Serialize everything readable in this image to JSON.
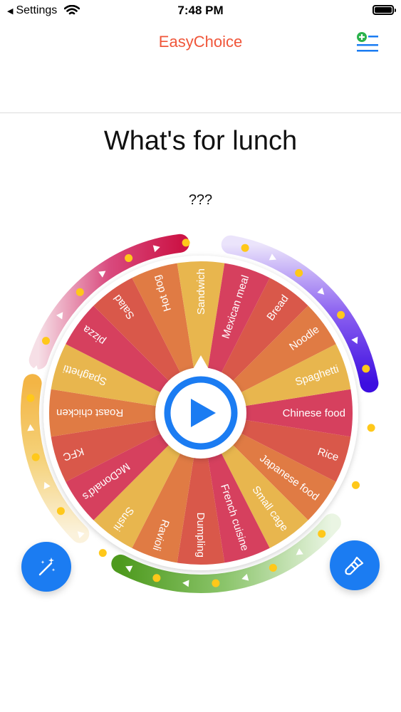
{
  "status": {
    "back_label": "Settings",
    "time": "7:48 PM"
  },
  "header": {
    "app_title": "EasyChoice",
    "list_icon": "add-list-icon"
  },
  "wheel": {
    "title": "What's for lunch",
    "result": "???",
    "items": [
      "Chinese food",
      "Rice",
      "Japanese food",
      "Small cage",
      "French cuisine",
      "Dumpling",
      "Ravioli",
      "Sushi",
      "McDonald's",
      "KFC",
      "Roast chicken",
      "Spaghetti",
      "pizza",
      "Salad",
      "Hot dog",
      "Sandwich",
      "Mexican meal",
      "Bread",
      "Noodle",
      "Spaghetti"
    ],
    "segment_colors": [
      "#d6405e",
      "#d9584a",
      "#e07b44",
      "#e8b64e"
    ],
    "play_icon": "play-icon"
  },
  "actions": {
    "left_icon": "magic-wand-icon",
    "right_icon": "paint-brush-icon"
  },
  "colors": {
    "accent": "#1b7cf2",
    "title": "#f0563a"
  }
}
